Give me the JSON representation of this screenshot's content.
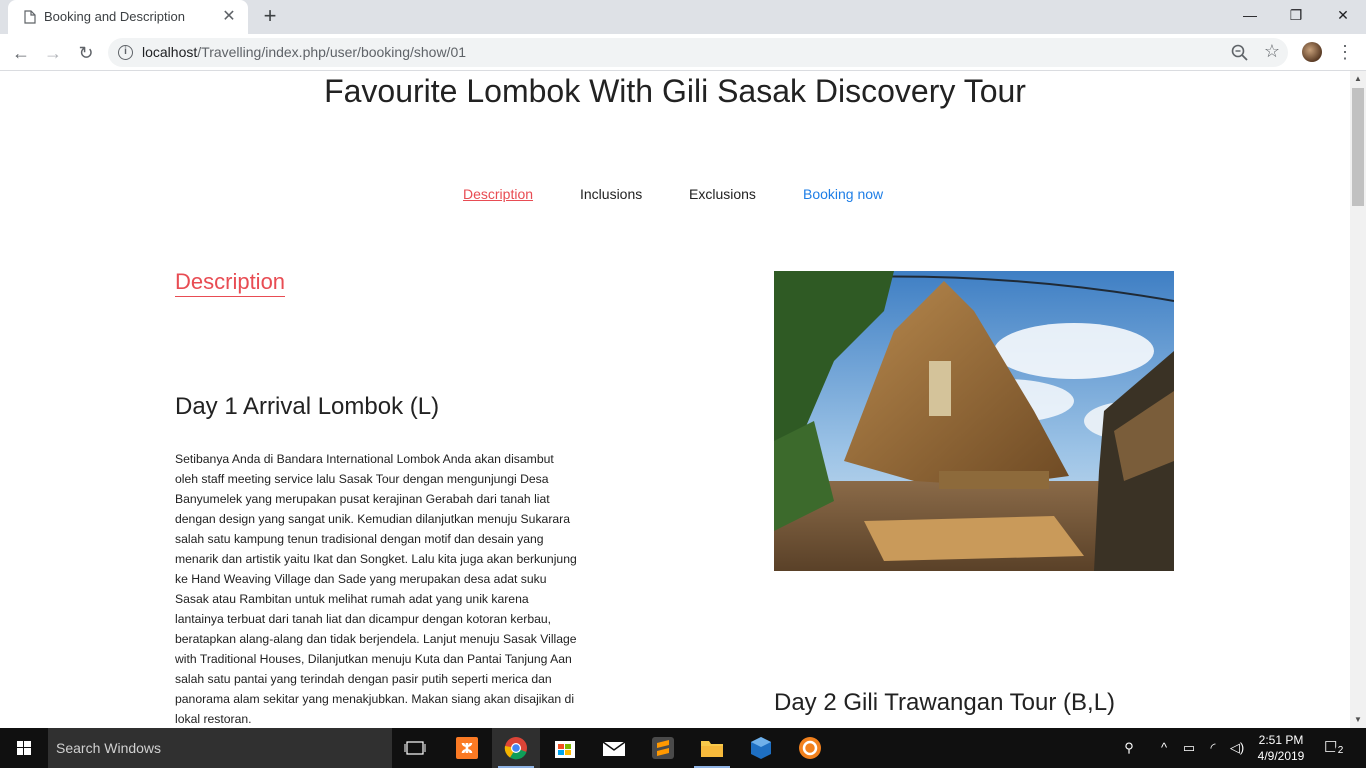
{
  "browser": {
    "tab_title": "Booking and Description",
    "tab_close": "✕",
    "new_tab": "+",
    "window_controls": {
      "minimize": "—",
      "maximize": "❐",
      "close": "✕"
    },
    "url_host": "localhost",
    "url_path": "/Travelling/index.php/user/booking/show/01"
  },
  "page": {
    "title": "Favourite Lombok With Gili Sasak Discovery Tour",
    "nav": {
      "description": "Description",
      "inclusions": "Inclusions",
      "exclusions": "Exclusions",
      "booking": "Booking now"
    },
    "section_heading": "Description",
    "day1": {
      "title": "Day 1 Arrival Lombok (L)",
      "text": "Setibanya Anda di Bandara International Lombok Anda akan disambut oleh staff meeting service lalu Sasak Tour dengan mengunjungi Desa Banyumelek yang merupakan pusat kerajinan Gerabah dari tanah liat dengan design yang sangat unik. Kemudian dilanjutkan menuju Sukarara salah satu kampung tenun tradisional dengan motif dan desain yang menarik dan artistik yaitu Ikat dan Songket. Lalu kita juga akan berkunjung ke Hand Weaving Village dan Sade yang merupakan desa adat suku Sasak atau Rambitan untuk melihat rumah adat yang unik karena lantainya terbuat dari tanah liat dan dicampur dengan kotoran kerbau, beratapkan alang-alang dan tidak berjendela. Lanjut menuju Sasak Village with Traditional Houses, Dilanjutkan menuju Kuta dan Pantai Tanjung Aan salah satu pantai yang terindah dengan pasir putih seperti merica dan panorama alam sekitar yang menakjubkan. Makan siang akan disajikan di lokal restoran."
    },
    "day2": {
      "title": "Day 2 Gili Trawangan Tour (B,L)"
    }
  },
  "taskbar": {
    "search_placeholder": "Search Windows",
    "time": "2:51 PM",
    "date": "4/9/2019",
    "notification_count": "2"
  },
  "colors": {
    "accent_red": "#e84c53",
    "link_blue": "#1e7ee6",
    "taskbar": "#101010"
  }
}
